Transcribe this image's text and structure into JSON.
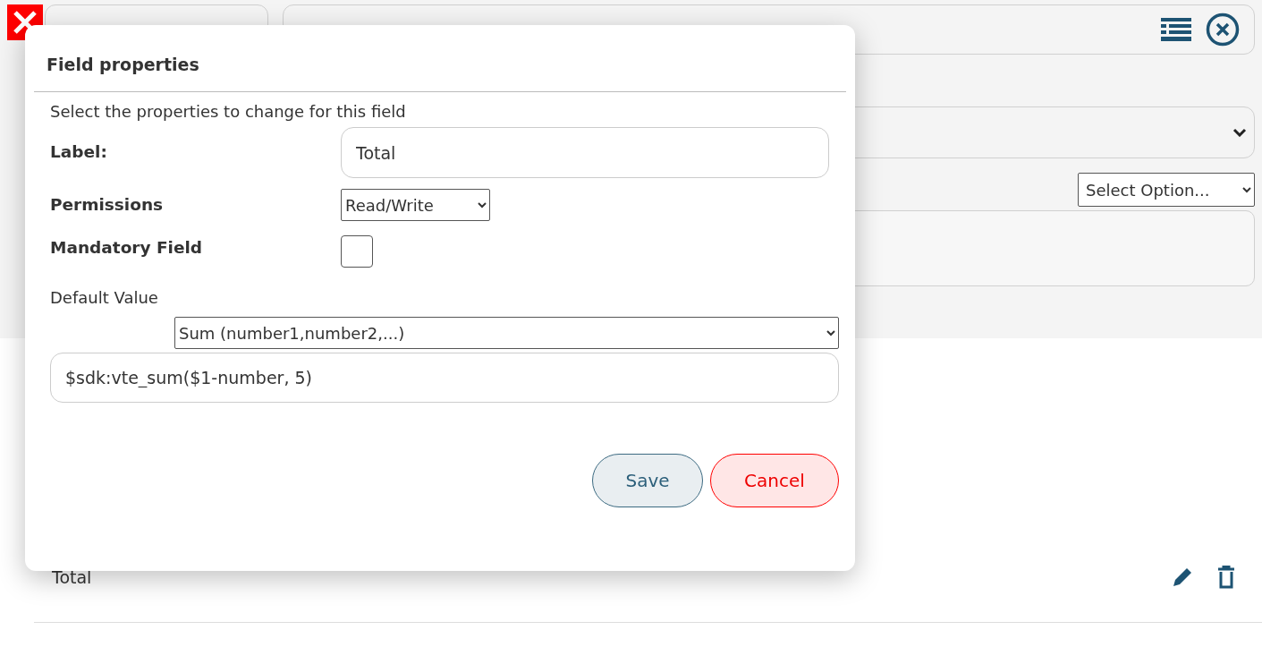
{
  "background": {
    "option_select": {
      "value": "Select Option..."
    },
    "rows": [
      {
        "label": "Total"
      }
    ]
  },
  "dialog": {
    "title": "Field properties",
    "hint": "Select the properties to change for this field",
    "fields": [
      {
        "kind": "text",
        "label": "Label:",
        "value": "Total"
      },
      {
        "kind": "select",
        "label": "Permissions",
        "value": "Read/Write"
      },
      {
        "kind": "checkbox",
        "label": "Mandatory Field",
        "checked": false
      }
    ],
    "default_value": {
      "label": "Default Value",
      "function": "Sum (number1,number2,...)",
      "value": "$sdk:vte_sum($1-number, 5)"
    },
    "buttons": [
      {
        "kind": "save",
        "label": "Save"
      },
      {
        "kind": "cancel",
        "label": "Cancel"
      }
    ]
  }
}
